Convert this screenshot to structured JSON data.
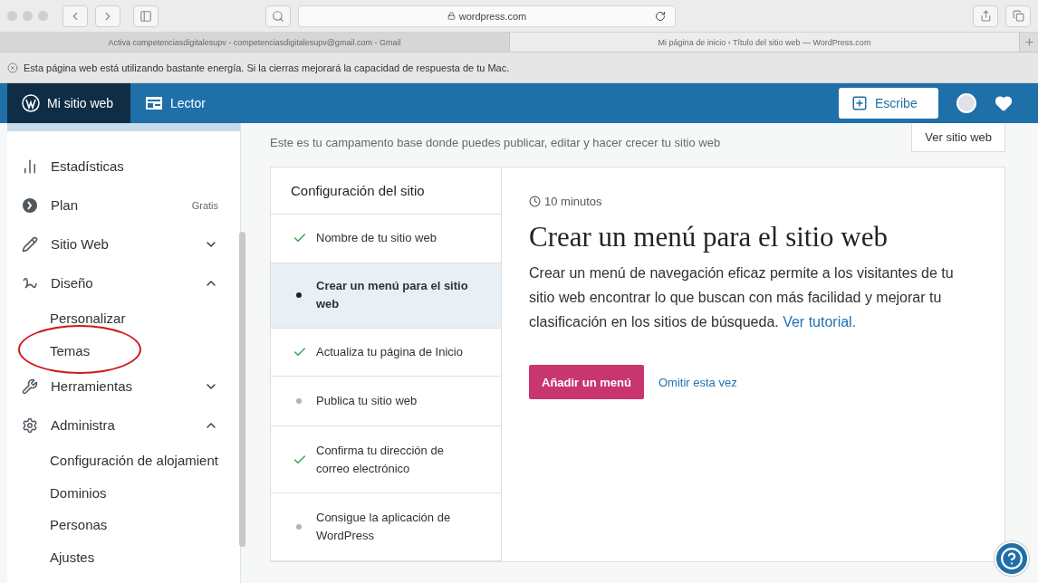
{
  "browser": {
    "url": "wordpress.com",
    "tabs": [
      {
        "title": "Activa competenciasdigitalesupv - competenciasdigitalesupv@gmail.com - Gmail",
        "selected": false
      },
      {
        "title": "Mi página de inicio ‹ Título del sitio web — WordPress.com",
        "selected": true
      }
    ],
    "banner": "Esta página web está utilizando bastante energía. Si la cierras mejorará la capacidad de respuesta de tu Mac."
  },
  "masterbar": {
    "items": [
      {
        "label": "Mi sitio web",
        "kind": "site",
        "selected": true
      },
      {
        "label": "Lector",
        "kind": "reader",
        "selected": false
      }
    ],
    "write_button": "Escribe"
  },
  "sidebar": {
    "items": [
      {
        "kind": "item",
        "label": "Estadísticas"
      },
      {
        "kind": "item",
        "label": "Plan",
        "badge": "Gratis"
      },
      {
        "kind": "item",
        "label": "Sitio Web",
        "expanded": false
      },
      {
        "kind": "item",
        "label": "Diseño",
        "expanded": true
      },
      {
        "kind": "subitem",
        "label": "Personalizar"
      },
      {
        "kind": "subitem",
        "label": "Temas",
        "circled": true
      },
      {
        "kind": "item",
        "label": "Herramientas",
        "expanded": false
      },
      {
        "kind": "item",
        "label": "Administra",
        "expanded": true
      },
      {
        "kind": "subitem",
        "label": "Configuración de alojamient"
      },
      {
        "kind": "subitem",
        "label": "Dominios"
      },
      {
        "kind": "subitem",
        "label": "Personas"
      },
      {
        "kind": "subitem",
        "label": "Ajustes"
      }
    ]
  },
  "main": {
    "subtitle": "Este es tu campamento base donde puedes publicar, editar y hacer crecer tu sitio web",
    "view_site_button": "Ver sitio web",
    "checklist": {
      "title": "Configuración del sitio",
      "items": [
        {
          "label": "Nombre de tu sitio web",
          "done": true,
          "selected": false
        },
        {
          "label": "Crear un menú para el sitio web",
          "done": false,
          "selected": true
        },
        {
          "label": "Actualiza tu página de Inicio",
          "done": true,
          "selected": false
        },
        {
          "label": "Publica tu sitio web",
          "done": false,
          "selected": false
        },
        {
          "label": "Confirma tu dirección de correo electrónico",
          "done": true,
          "selected": false
        },
        {
          "label": "Consigue la aplicación de WordPress",
          "done": false,
          "selected": false
        }
      ]
    },
    "task": {
      "duration": "10 minutos",
      "title": "Crear un menú para el sitio web",
      "description": "Crear un menú de navegación eficaz permite a los visitantes de tu sitio web encontrar lo que buscan con más facilidad y mejorar tu clasificación en los sitios de búsqueda.",
      "link": "Ver tutorial.",
      "primary_button": "Añadir un menú",
      "secondary_button": "Omitir esta vez"
    }
  }
}
